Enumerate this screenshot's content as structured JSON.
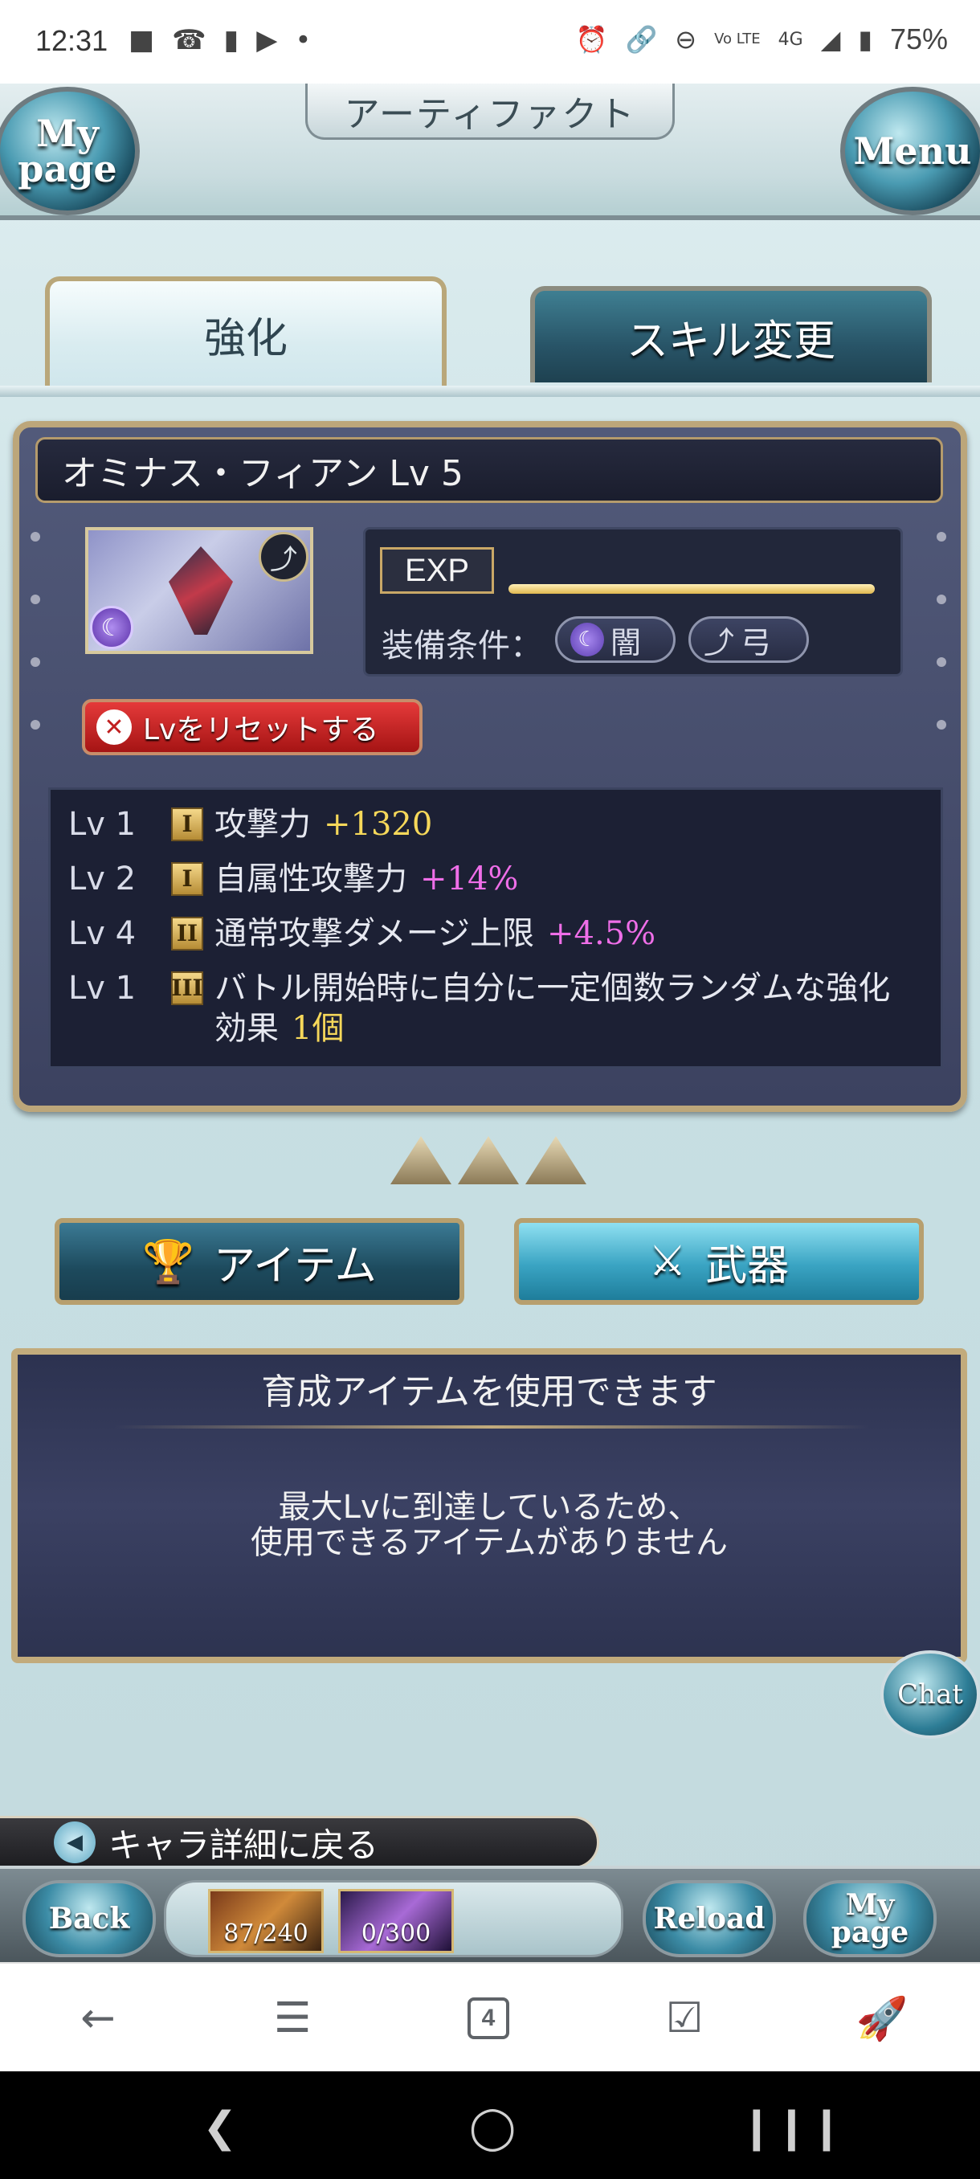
{
  "status_bar": {
    "time": "12:31",
    "battery": "75%",
    "network": "4G",
    "lte": "Vo LTE"
  },
  "header": {
    "title": "アーティファクト",
    "mypage_label": "My page",
    "menu_label": "Menu"
  },
  "tabs": [
    {
      "label": "強化",
      "active": true
    },
    {
      "label": "スキル変更",
      "active": false
    }
  ],
  "artifact": {
    "name": "オミナス・フィアン Lv 5",
    "exp_label": "EXP",
    "equip_label": "装備条件：",
    "element": "闇",
    "weapon_type": "弓",
    "reset_button": "Lvをリセットする",
    "skills": [
      {
        "lv": "Lv 1",
        "rank": "I",
        "desc": "攻撃力",
        "value": "+1320",
        "value_color": "#f6d85a"
      },
      {
        "lv": "Lv 2",
        "rank": "I",
        "desc": "自属性攻撃力",
        "value": "+14%",
        "value_color": "#ef6ee8"
      },
      {
        "lv": "Lv 4",
        "rank": "II",
        "desc": "通常攻撃ダメージ上限",
        "value": "+4.5%",
        "value_color": "#ef6ee8"
      },
      {
        "lv": "Lv 1",
        "rank": "III",
        "desc": "バトル開始時に自分に一定個数ランダムな強化効果",
        "value": "1個",
        "value_color": "#f6d85a"
      }
    ]
  },
  "material_tabs": {
    "item_label": "アイテム",
    "weapon_label": "武器"
  },
  "info_panel": {
    "heading": "育成アイテムを使用できます",
    "message_line1": "最大Lvに到達しているため、",
    "message_line2": "使用できるアイテムがありません"
  },
  "chat_label": "Chat",
  "back_to_character": "キャラ詳細に戻る",
  "footer": {
    "back_label": "Back",
    "reload_label": "Reload",
    "mypage_label": "My page",
    "ap": "87/240",
    "bp": "0/300"
  },
  "browser": {
    "tab_count": "4"
  },
  "colors": {
    "accent_gold": "#bca67a",
    "panel_bg": "#3c4260",
    "teal": "#2d7d96"
  }
}
